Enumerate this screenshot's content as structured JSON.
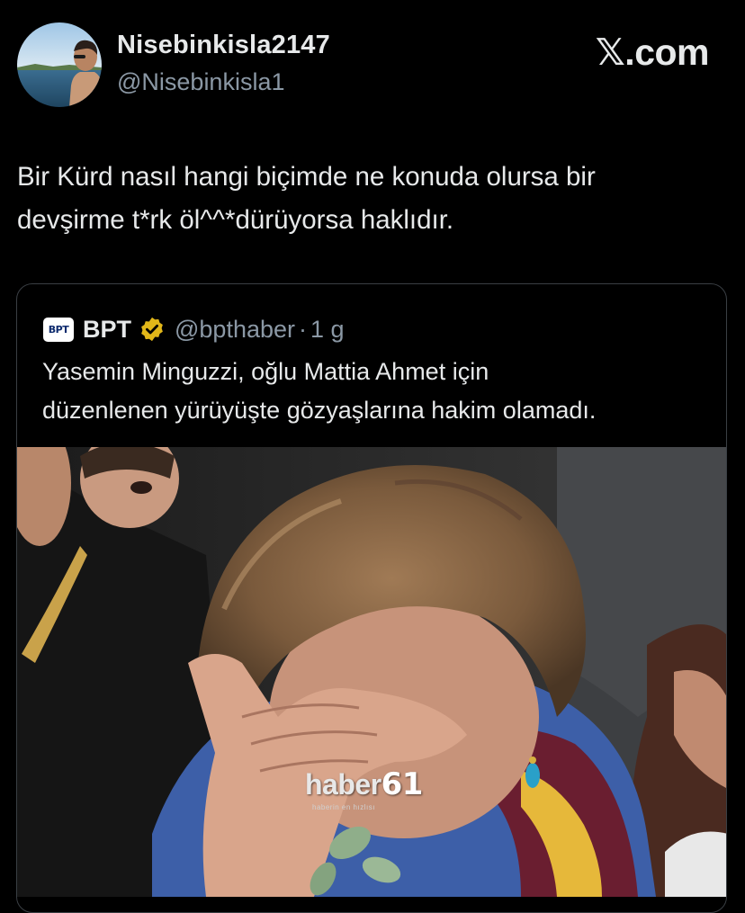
{
  "author": {
    "display_name": "Nisebinkisla2147",
    "handle": "@Nisebinkisla1",
    "avatar_icon": "profile-photo"
  },
  "site": {
    "logo_text": "𝕏.com"
  },
  "tweet": {
    "text": "Bir Kürd nasıl hangi biçimde ne konuda olursa bir\ndevşirme t*rk öl^^*dürüyorsa haklıdır."
  },
  "quote": {
    "logo_text": "BPT",
    "name": "BPT",
    "verified_icon": "gold-verified-badge-icon",
    "handle": "@bpthaber",
    "separator": "·",
    "time": "1 g",
    "text": "Yasemin Minguzzi, oğlu Mattia Ahmet için\ndüzenlenen yürüyüşte gözyaşlarına hakim olamadı.",
    "media": {
      "watermark_text": "haber",
      "watermark_number": "61",
      "watermark_sub": "haberin en hızlısı"
    }
  },
  "colors": {
    "background": "#000000",
    "text_primary": "#e7e9ea",
    "text_secondary": "#8b98a5",
    "border": "#3a3f44",
    "verified_gold": "#e2b719"
  }
}
